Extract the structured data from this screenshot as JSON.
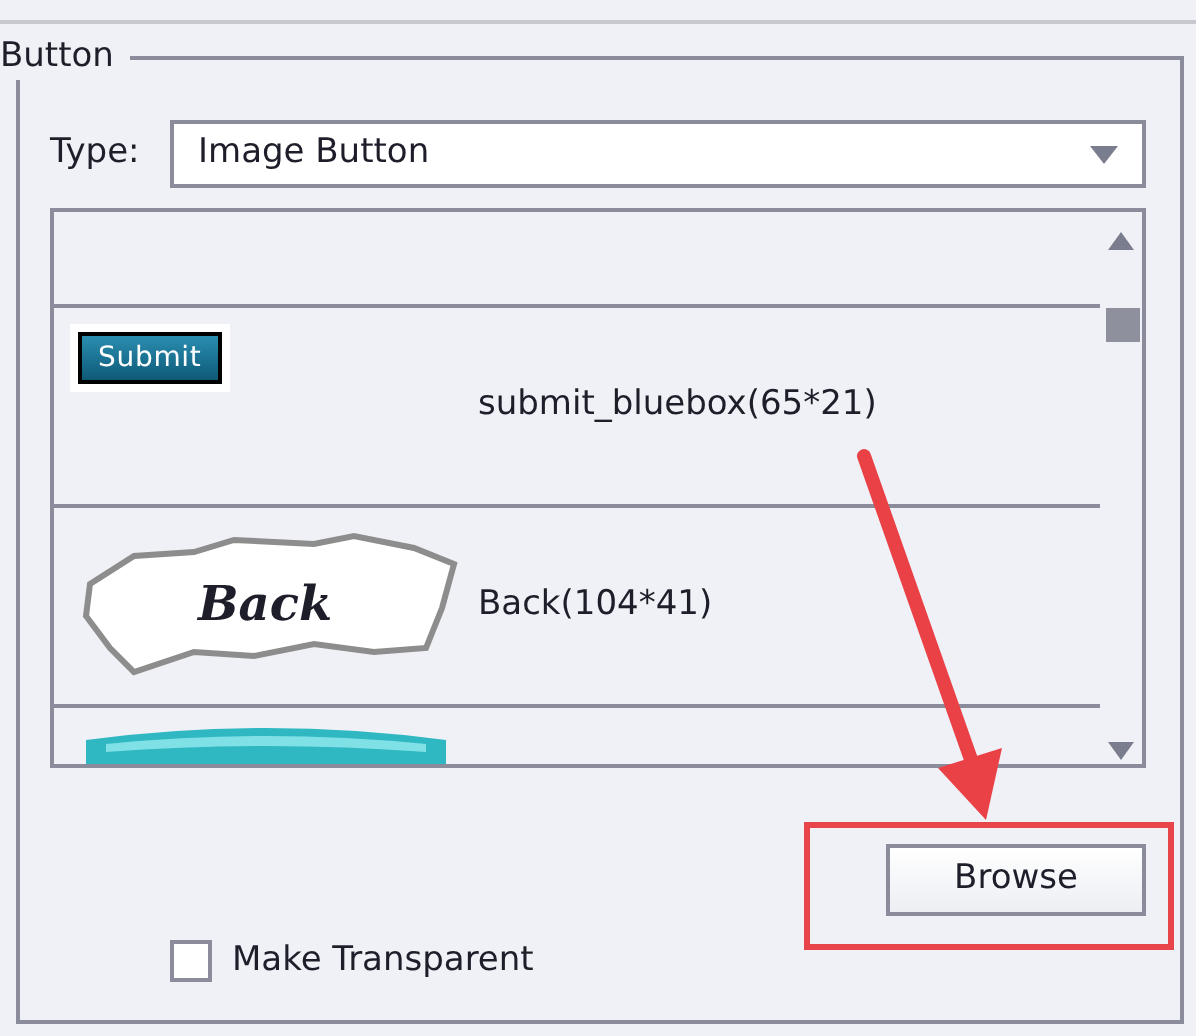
{
  "group": {
    "title": "Button"
  },
  "type_field": {
    "label": "Type:",
    "value": "Image Button"
  },
  "image_list": [
    {
      "kind": "cut"
    },
    {
      "kind": "submit",
      "caption": "Submit",
      "label": "submit_bluebox(65*21)"
    },
    {
      "kind": "torn",
      "caption": "Back",
      "label": "Back(104*41)"
    },
    {
      "kind": "glossy"
    }
  ],
  "browse_button": {
    "label": "Browse"
  },
  "make_transparent": {
    "label": "Make Transparent",
    "checked": false
  }
}
